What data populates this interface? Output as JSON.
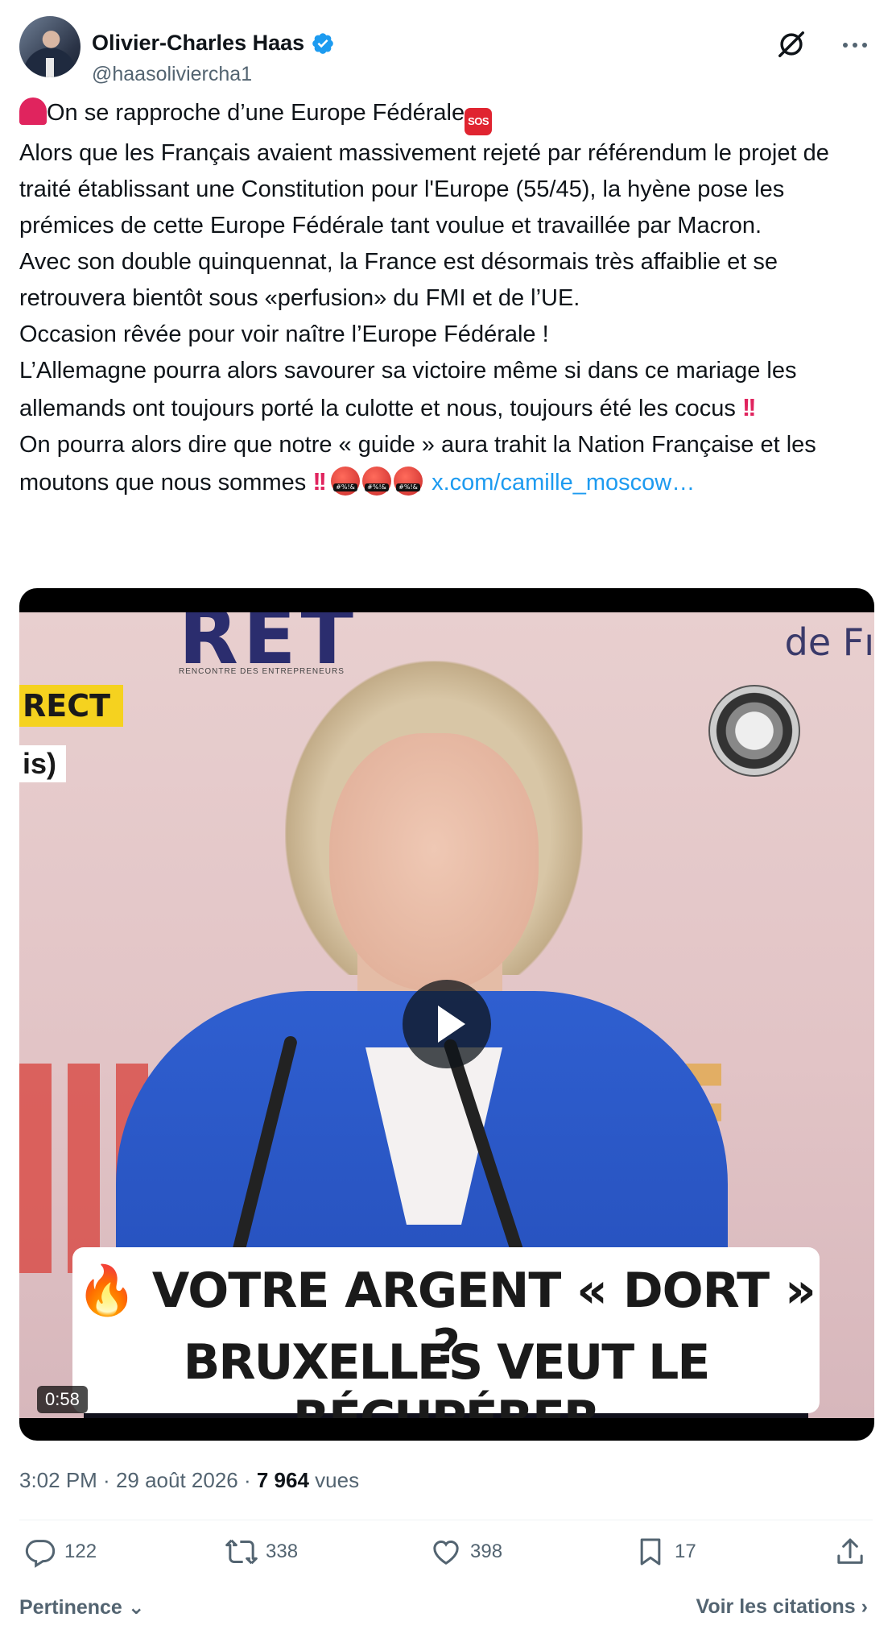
{
  "author": {
    "name": "Olivier-Charles Haas",
    "handle": "@haasoliviercha1",
    "verified": true
  },
  "tweet": {
    "line1": "On se rapproche d’une Europe Fédérale",
    "para1": "Alors que les Français avaient  massivement rejeté  par référendum le projet de traité établissant une Constitution pour l'Europe (55/45), la hyène pose les prémices de cette Europe Fédérale tant voulue et travaillée par Macron.",
    "para2": "Avec son double quinquennat, la France est désormais très affaiblie et se retrouvera bientôt sous «perfusion» du FMI et de l’UE.",
    "para3": "Occasion rêvée pour voir naître l’Europe Fédérale !",
    "para4": "L’Allemagne pourra alors savourer sa victoire même si dans ce mariage les allemands ont toujours porté la culotte et nous, toujours été les cocus",
    "para5": "On pourra alors dire que notre « guide » aura trahit la Nation Française et les moutons que nous sommes",
    "link": "x.com/camille_moscow…",
    "emoji_sos": "SOS",
    "emoji_bang": "!!",
    "emoji_angry_symbols": "#%!&"
  },
  "video": {
    "duration": "0:58",
    "caption_line1": "VOTRE ARGENT « DORT » ?",
    "caption_line2": "BRUXELLES VEUT LE RÉCUPÉRER",
    "caption_emoji": "🔥",
    "overlay_direct": "RECT",
    "overlay_is": "is)",
    "backdrop_ret": "RET",
    "backdrop_sub": "RENCONTRE DES ENTREPRENEURS",
    "backdrop_defr": "de Fı"
  },
  "meta": {
    "time": "3:02 PM",
    "separator": " · ",
    "date": "29 août 2026",
    "views_count": "7 964",
    "views_label": " vues"
  },
  "actions": {
    "replies": "122",
    "reposts": "338",
    "likes": "398",
    "bookmarks": "17"
  },
  "footer": {
    "sort_label": "Pertinence",
    "quotes_label": "Voir les citations"
  },
  "colors": {
    "link": "#1d9bf0",
    "secondary_text": "#536471",
    "verified": "#1d9bf0"
  }
}
